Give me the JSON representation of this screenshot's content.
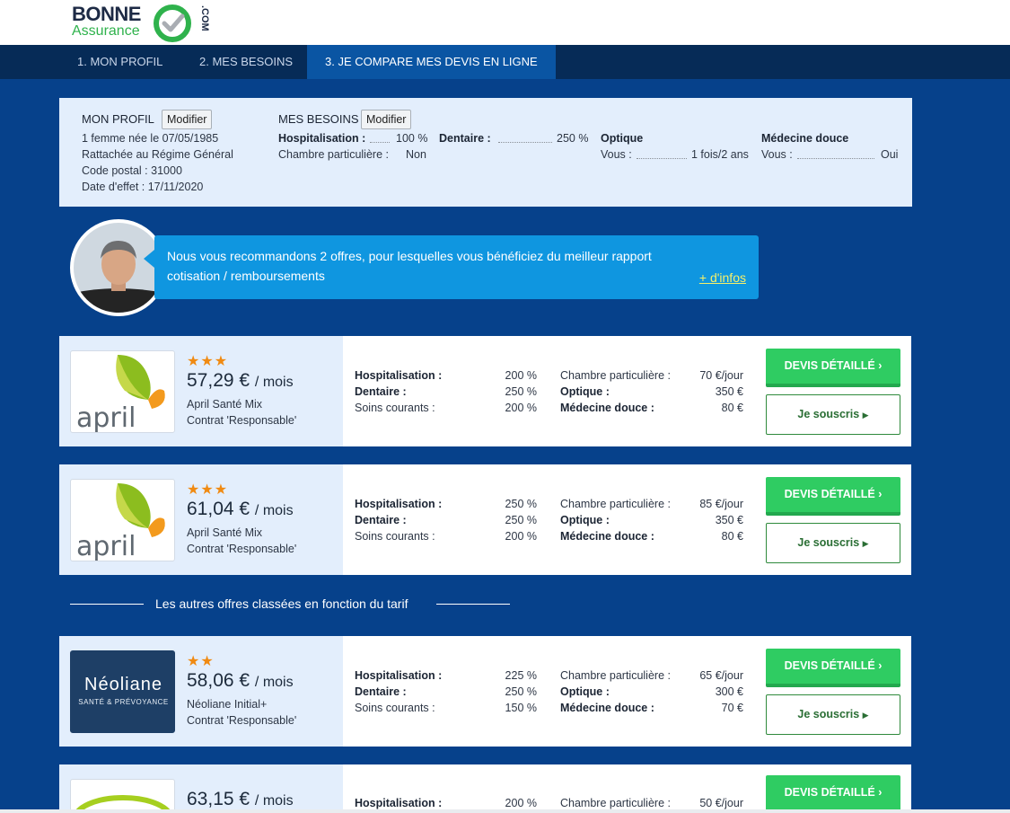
{
  "logo": {
    "word1": "BONNE",
    "word2": "Assurance",
    "suffix": ".COM"
  },
  "nav": {
    "tabs": [
      "1. MON PROFIL",
      "2. MES BESOINS",
      "3. JE COMPARE MES DEVIS EN LIGNE"
    ],
    "active": 2
  },
  "summary": {
    "profile_title": "MON PROFIL",
    "modify_label": "Modifier",
    "profile_lines": [
      "1 femme née le 07/05/1985",
      "Rattachée au Régime Général",
      "Code postal : 31000",
      "Date d'effet : 17/11/2020"
    ],
    "needs_title": "MES BESOINS",
    "hosp_label": "Hospitalisation :",
    "hosp_value": "100 %",
    "dent_label": "Dentaire :",
    "dent_value": "250 %",
    "chambre_label": "Chambre particulière :",
    "chambre_value": "Non",
    "optique_title": "Optique",
    "optique_label": "Vous :",
    "optique_value": "1 fois/2 ans",
    "medecine_title": "Médecine douce",
    "medecine_label": "Vous :",
    "medecine_value": "Oui"
  },
  "advisor": {
    "message": "Nous vous recommandons 2 offres, pour lesquelles vous bénéficiez du meilleur rapport cotisation / remboursements",
    "more": "+ d'infos"
  },
  "labels": {
    "hosp": "Hospitalisation :",
    "dent": "Dentaire :",
    "soins": "Soins courants :",
    "chambre": "Chambre particulière :",
    "optique": "Optique :",
    "medecine": "Médecine douce :",
    "devis_btn": "DEVIS DÉTAILLÉ",
    "souscris_btn": "Je souscris",
    "per_month": "/ mois"
  },
  "separator": "Les autres offres classées en fonction du tarif",
  "offers": [
    {
      "insurer": "april",
      "stars": "★★★",
      "rating": 3,
      "price": "57,29 €",
      "product": "April Santé Mix",
      "contract": "Contrat 'Responsable'",
      "hosp": "200 %",
      "dent": "250 %",
      "soins": "200 %",
      "chambre": "70 €/jour",
      "optique": "350 €",
      "medecine": "80 €"
    },
    {
      "insurer": "april",
      "stars": "★★★",
      "rating": 3,
      "price": "61,04 €",
      "product": "April Santé Mix",
      "contract": "Contrat 'Responsable'",
      "hosp": "250 %",
      "dent": "250 %",
      "soins": "200 %",
      "chambre": "85 €/jour",
      "optique": "350 €",
      "medecine": "80 €"
    },
    {
      "insurer": "Néoliane",
      "insurer_tagline": "SANTÉ & PRÉVOYANCE",
      "stars": "★★",
      "rating": 2,
      "price": "58,06 €",
      "product": "Néoliane Initial+",
      "contract": "Contrat 'Responsable'",
      "hosp": "225 %",
      "dent": "250 %",
      "soins": "150 %",
      "chambre": "65 €/jour",
      "optique": "300 €",
      "medecine": "70 €"
    },
    {
      "price": "63,15 €",
      "hosp": "200 %",
      "chambre": "50 €/jour"
    }
  ],
  "colors": {
    "background": "#06418b",
    "nav": "#062b57",
    "accent_green": "#2fcc62",
    "bubble": "#0f96e0",
    "star": "#f08a12"
  }
}
